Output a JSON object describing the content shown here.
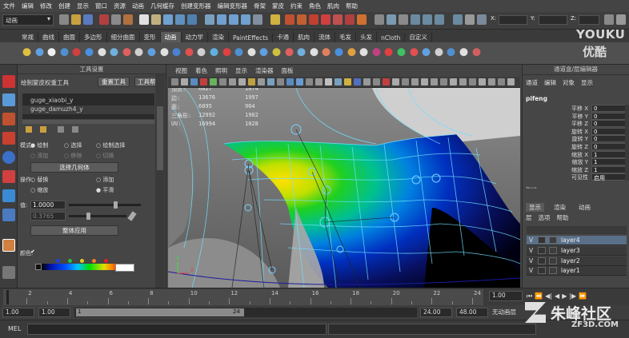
{
  "menubar": [
    "文件",
    "编辑",
    "修改",
    "创建",
    "显示",
    "窗口",
    "资源",
    "动画",
    "几何缓存",
    "创建变形器",
    "编辑变形器",
    "骨架",
    "蒙皮",
    "约束",
    "角色",
    "肌肉",
    "帮助"
  ],
  "status": {
    "mode": "动画",
    "x_label": "X:",
    "y_label": "Y:",
    "z_label": "Z:"
  },
  "shelf_tabs": [
    "常规",
    "曲线",
    "曲面",
    "多边形",
    "细分曲面",
    "变形",
    "动画",
    "动力学",
    "渲染",
    "PaintEffects",
    "卡通",
    "肌肉",
    "流体",
    "毛发",
    "头发",
    "nCloth",
    "自定义"
  ],
  "shelf_active": "动画",
  "tool_settings": {
    "title": "工具设置",
    "tool_name": "绘制蒙皮权重工具",
    "reset_btn": "重置工具",
    "help_btn": "工具帮助",
    "influences": [
      "guge_xiaobi_y",
      "guge_damuzh4_y"
    ],
    "mode_label": "模式:",
    "mode_options": [
      "绘制",
      "选择",
      "绘制选择"
    ],
    "select_options": [
      "添加",
      "移除",
      "切换"
    ],
    "select_geometry_btn": "选择几何体",
    "op_label": "操作:",
    "op_options": [
      "替换",
      "添加",
      "缩放",
      "平滑"
    ],
    "value_label": "值:",
    "value": "1.0000",
    "minmax_value": "0.3765",
    "flood_btn": "整体应用",
    "color_label": "颜色:"
  },
  "viewport": {
    "menu": [
      "视图",
      "着色",
      "照明",
      "显示",
      "渲染器",
      "面板"
    ],
    "hud": [
      {
        "label": "顶点:",
        "col1": "6827",
        "col2": "1074"
      },
      {
        "label": "边:",
        "col1": "13676",
        "col2": "1997"
      },
      {
        "label": "面:",
        "col1": "6895",
        "col2": "964"
      },
      {
        "label": "三角形:",
        "col1": "12992",
        "col2": "1902"
      },
      {
        "label": "UV:",
        "col1": "16994",
        "col2": "1028"
      }
    ],
    "axis_x": "X",
    "axis_y": "Y"
  },
  "channel_box": {
    "tabs": [
      "通道盒/层编辑器"
    ],
    "menu": [
      "通道",
      "编辑",
      "对象",
      "显示"
    ],
    "object": "pifeng",
    "attrs": [
      {
        "name": "平移 X",
        "value": "0"
      },
      {
        "name": "平移 Y",
        "value": "0"
      },
      {
        "name": "平移 Z",
        "value": "0"
      },
      {
        "name": "旋转 X",
        "value": "0"
      },
      {
        "name": "旋转 Y",
        "value": "0"
      },
      {
        "name": "旋转 Z",
        "value": "0"
      },
      {
        "name": "缩放 X",
        "value": "1"
      },
      {
        "name": "缩放 Y",
        "value": "1"
      },
      {
        "name": "缩放 Z",
        "value": "1"
      },
      {
        "name": "可见性",
        "value": "启用"
      }
    ],
    "shapes_label": "形状"
  },
  "layer_editor": {
    "tabs": [
      "显示",
      "渲染",
      "动画"
    ],
    "menu": [
      "层",
      "选项",
      "帮助"
    ],
    "layers": [
      {
        "v": "V",
        "name": "layer4"
      },
      {
        "v": "V",
        "name": "layer3"
      },
      {
        "v": "V",
        "name": "layer2"
      },
      {
        "v": "V",
        "name": "layer1"
      }
    ]
  },
  "timeline": {
    "ticks": [
      "2",
      "4",
      "6",
      "8",
      "10",
      "12",
      "14",
      "16",
      "18",
      "20",
      "22",
      "24"
    ],
    "current_frame": "1.00"
  },
  "range": {
    "start": "1.00",
    "start2": "1.00",
    "range_start": "1",
    "range_end": "24",
    "end": "24.00",
    "end2": "48.00",
    "anim_layer": "无动画层"
  },
  "cmdline": {
    "label": "MEL"
  },
  "watermark": {
    "youku": "YOUKU",
    "youku_cn": "优酷",
    "zf3d": "朱峰社区",
    "zf3d_url": "ZF3D.COM"
  }
}
